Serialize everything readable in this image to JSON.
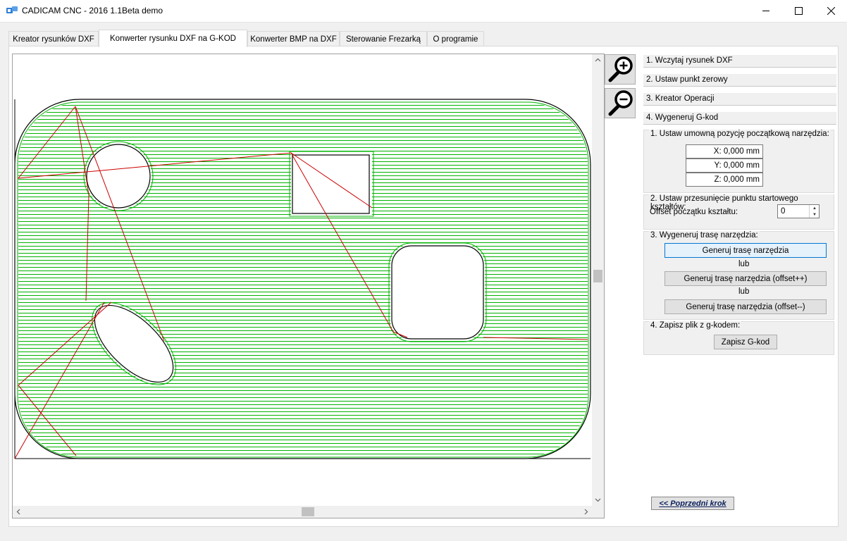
{
  "window": {
    "title": "CADICAM CNC - 2016 1.1Beta demo",
    "controls": {
      "minimize": "minimize-icon",
      "maximize": "maximize-icon",
      "close": "close-icon"
    }
  },
  "tabs": [
    {
      "label": "Kreator rysunków DXF",
      "active": false
    },
    {
      "label": "Konwerter rysunku DXF na G-KOD",
      "active": true
    },
    {
      "label": "Konwerter BMP na DXF",
      "active": false
    },
    {
      "label": "Sterowanie Frezarką",
      "active": false
    },
    {
      "label": "O programie",
      "active": false
    }
  ],
  "zoom": {
    "in_icon": "zoom-in-icon",
    "out_icon": "zoom-out-icon"
  },
  "steps": [
    {
      "label": "1. Wczytaj rysunek DXF"
    },
    {
      "label": "2. Ustaw punkt zerowy"
    },
    {
      "label": "3. Kreator Operacji"
    },
    {
      "label": "4. Wygeneruj G-kod"
    }
  ],
  "group1": {
    "title": "1. Ustaw umowną pozycję początkową narzędzia:",
    "x": "X: 0,000 mm",
    "y": "Y: 0,000 mm",
    "z": "Z: 0,000 mm"
  },
  "group2": {
    "title": "2. Ustaw przesunięcie punktu startowego kształtów:",
    "offset_label": "Offset początku kształtu:",
    "offset_value": "0"
  },
  "group3": {
    "title": "3. Wygeneruj trasę narzędzia:",
    "btn_generate": "Generuj trasę narzędzia",
    "or1": "lub",
    "btn_generate_plus": "Generuj trasę narzędzia (offset++)",
    "or2": "lub",
    "btn_generate_minus": "Generuj trasę narzędzia (offset--)"
  },
  "group4": {
    "title": "4. Zapisz plik z g-kodem:",
    "btn_save": "Zapisz G-kod"
  },
  "back_button": "<< Poprzedni krok",
  "colors": {
    "contour": "#000000",
    "toolpath": "#00b300",
    "rapid": "#cc0000",
    "accent": "#0078d7"
  }
}
